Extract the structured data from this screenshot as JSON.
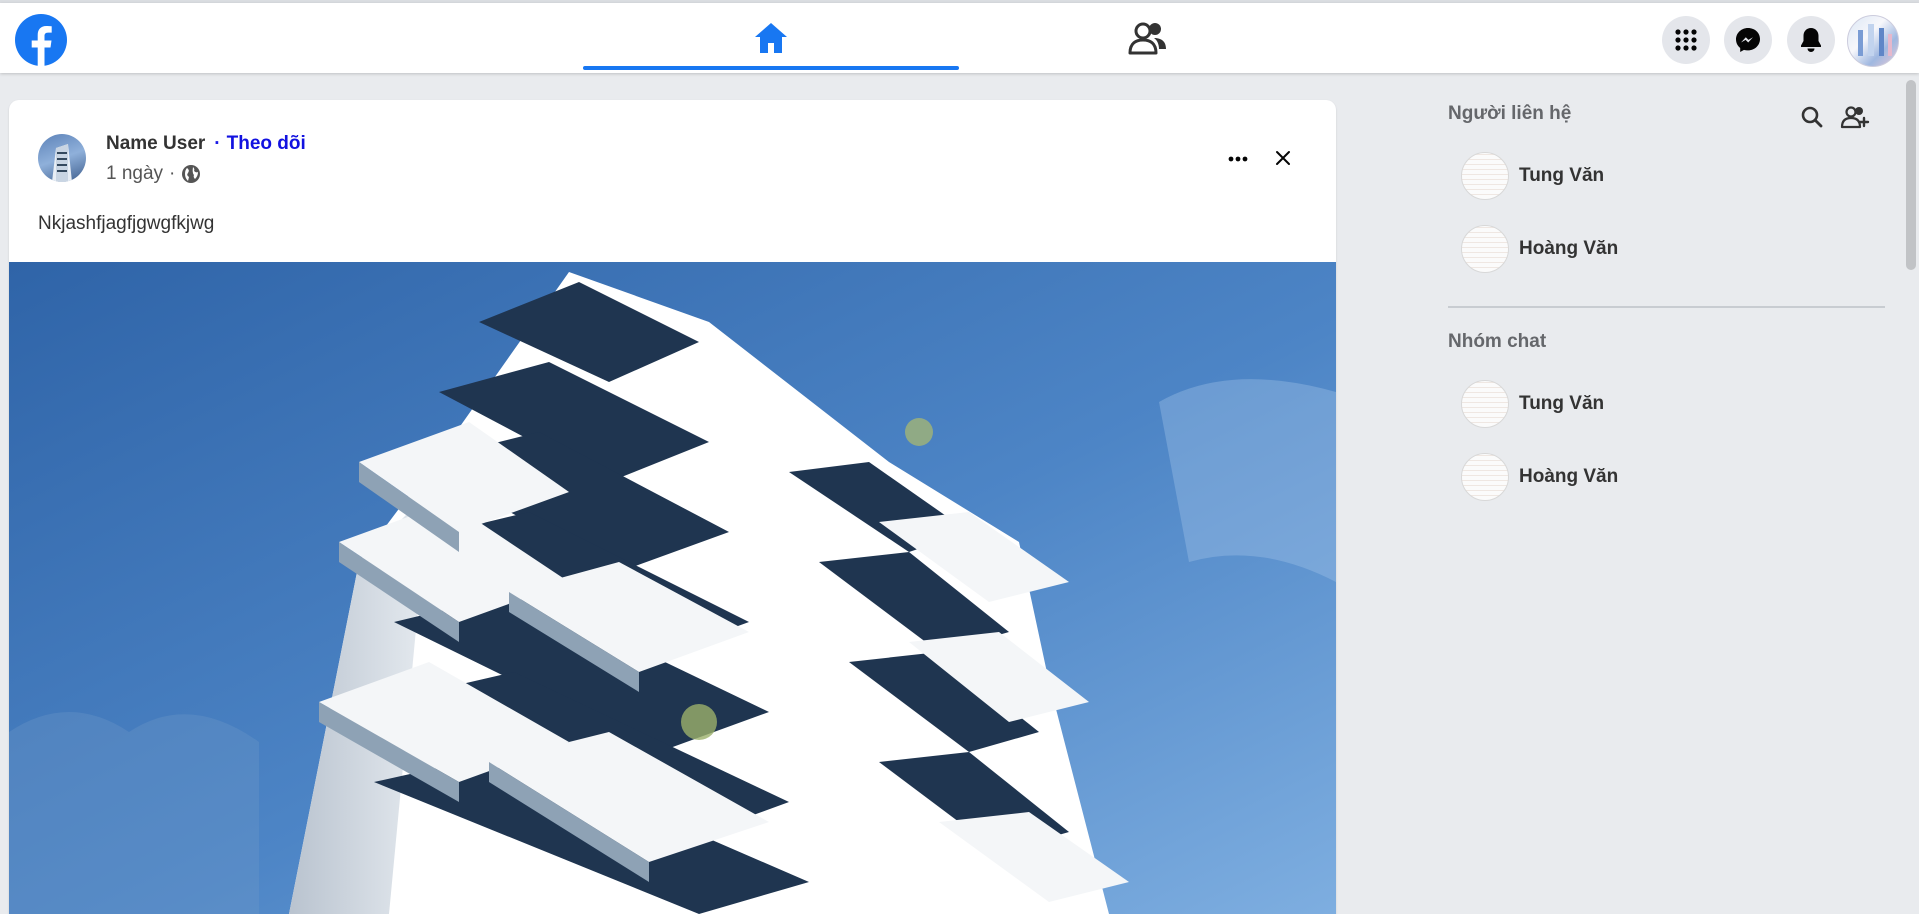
{
  "colors": {
    "brand": "#1877f2",
    "follow_link": "#1212e0",
    "sky": "#3e74b5"
  },
  "navbar": {
    "logo_icon": "facebook-logo-icon",
    "tabs": [
      {
        "name": "home",
        "icon": "home-icon",
        "active": true
      },
      {
        "name": "friends",
        "icon": "friends-icon",
        "active": false
      }
    ],
    "actions": [
      {
        "name": "menu",
        "icon": "grid-menu-icon"
      },
      {
        "name": "messenger",
        "icon": "messenger-icon"
      },
      {
        "name": "notifications",
        "icon": "bell-icon"
      }
    ]
  },
  "post": {
    "author": "Name User",
    "separator": "·",
    "follow_label": "Theo dõi",
    "time": "1 ngày",
    "meta_separator": "·",
    "privacy_icon": "globe-icon",
    "text": "Nkjashfjagfjgwgfkjwg",
    "image_icon": "building-photo"
  },
  "sidebar": {
    "contacts_title": "Người liên hệ",
    "contacts": [
      {
        "name": "Tung Văn"
      },
      {
        "name": "Hoàng Văn"
      }
    ],
    "groups_title": "Nhóm chat",
    "groups": [
      {
        "name": "Tung Văn"
      },
      {
        "name": "Hoàng Văn"
      }
    ]
  }
}
